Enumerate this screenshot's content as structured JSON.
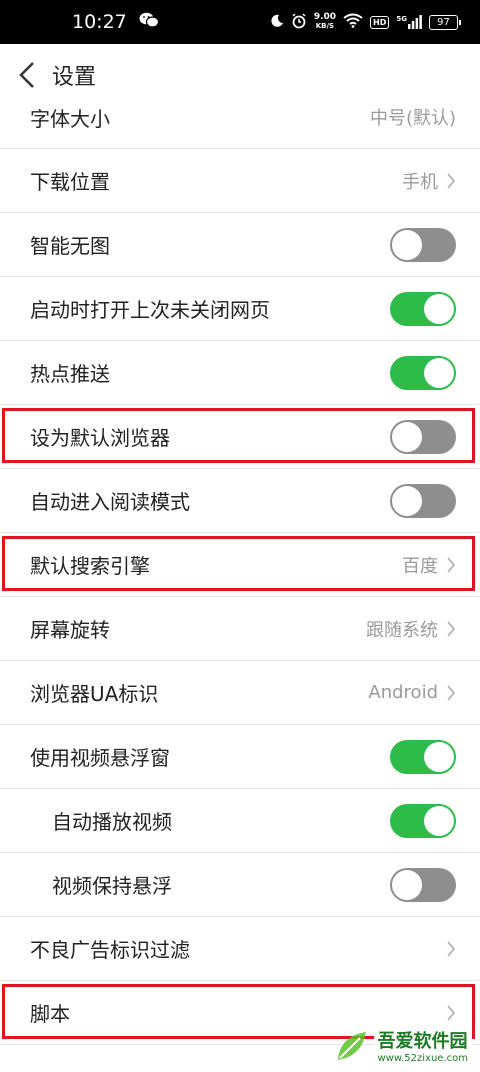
{
  "status_bar": {
    "time": "10:27",
    "net_speed_value": "9.00",
    "net_speed_unit": "KB/S",
    "hd": "HD",
    "signal": "5G",
    "battery": "97"
  },
  "header": {
    "title": "设置"
  },
  "settings": {
    "font_size": {
      "label": "字体大小",
      "value": "中号(默认)"
    },
    "download_location": {
      "label": "下载位置",
      "value": "手机"
    },
    "smart_no_image": {
      "label": "智能无图",
      "enabled": false
    },
    "restore_last_pages": {
      "label": "启动时打开上次未关闭网页",
      "enabled": true
    },
    "hot_push": {
      "label": "热点推送",
      "enabled": true
    },
    "set_default_browser": {
      "label": "设为默认浏览器",
      "enabled": false
    },
    "auto_reading_mode": {
      "label": "自动进入阅读模式",
      "enabled": false
    },
    "default_search_engine": {
      "label": "默认搜索引擎",
      "value": "百度"
    },
    "screen_rotation": {
      "label": "屏幕旋转",
      "value": "跟随系统"
    },
    "browser_ua": {
      "label": "浏览器UA标识",
      "value": "Android"
    },
    "video_float_window": {
      "label": "使用视频悬浮窗",
      "enabled": true
    },
    "autoplay_video": {
      "label": "自动播放视频",
      "enabled": true
    },
    "keep_video_floating": {
      "label": "视频保持悬浮",
      "enabled": false
    },
    "ad_filter": {
      "label": "不良广告标识过滤"
    },
    "script": {
      "label": "脚本"
    }
  },
  "watermark": {
    "name": "吾爱软件园",
    "url": "www.52zixue.com"
  },
  "colors": {
    "toggle_on": "#2dbb4a",
    "toggle_off": "#8e8e8e",
    "highlight_box": "#e0141e"
  }
}
